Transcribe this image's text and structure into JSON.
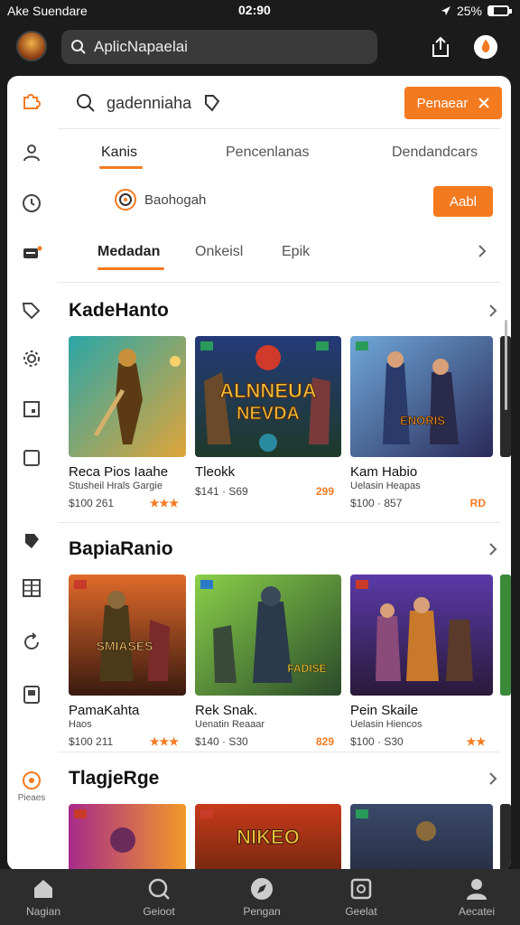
{
  "status": {
    "carrier": "Ake Suendare",
    "time": "02:90",
    "battery_text": "25%",
    "battery_level": 0.25
  },
  "header": {
    "search_placeholder": "AplicNapaelai"
  },
  "searchbar": {
    "query": "gadenniaha",
    "button": "Penaear"
  },
  "tabs1": [
    "Kanis",
    "Pencenlanas",
    "Dendandcars"
  ],
  "filter": {
    "label": "Baohogah",
    "button": "Aabl"
  },
  "tabs2": [
    "Medadan",
    "Onkeisl",
    "Epik"
  ],
  "sections": [
    {
      "title": "KadeHanto",
      "items": [
        {
          "name": "Reca Pios Iaahe",
          "sub": "Stusheil Hrals Gargie",
          "price": "$100 261",
          "rating": "★★★"
        },
        {
          "name": "Tleokk",
          "sub": "",
          "price": "$141 · S69",
          "rating": "299"
        },
        {
          "name": "Kam Habio",
          "sub": "Uelasin Heapas",
          "price": "$100 · 857",
          "rating": "RD"
        }
      ],
      "poster_texts": [
        "ALNNEUA",
        "NEVDA",
        "ENORIS"
      ]
    },
    {
      "title": "BapiaRanio",
      "items": [
        {
          "name": "PamaKahta",
          "sub": "Haos",
          "price": "$100 211",
          "rating": "★★★"
        },
        {
          "name": "Rek Snak.",
          "sub": "Uenatin Reaaar",
          "price": "$140 · S30",
          "rating": "829"
        },
        {
          "name": "Pein Skaile",
          "sub": "Uelasin Hiencos",
          "price": "$100 · S30",
          "rating": "★★"
        }
      ],
      "poster_texts": [
        "SMIASES",
        "FADISE"
      ]
    },
    {
      "title": "TlagjeRge",
      "items": [
        {
          "name": "",
          "sub": "",
          "price": "",
          "rating": ""
        },
        {
          "name": "",
          "sub": "",
          "price": "",
          "rating": ""
        },
        {
          "name": "",
          "sub": "",
          "price": "",
          "rating": ""
        }
      ],
      "poster_texts": [
        "NIKEO"
      ]
    }
  ],
  "rail_labels": {
    "bottom": "Pieaes"
  },
  "bottomnav": [
    "Nagian",
    "Geioot",
    "Pengan",
    "Geelat",
    "Aecatei"
  ],
  "colors": {
    "accent": "#f47a20",
    "dark": "#1b1b1b"
  }
}
